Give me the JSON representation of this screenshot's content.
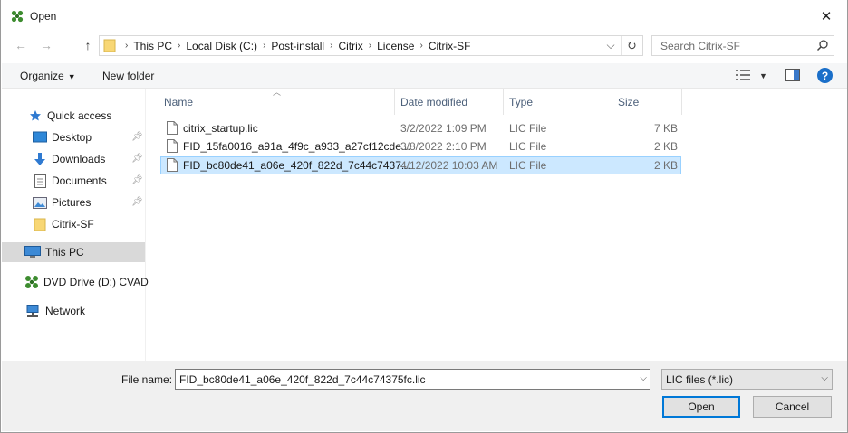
{
  "window": {
    "title": "Open",
    "close_glyph": "✕"
  },
  "nav_buttons": {
    "back": "←",
    "forward": "→",
    "up": "↑",
    "refresh": "↻",
    "address_dropdown": "⌵"
  },
  "address": {
    "crumbs": [
      "This PC",
      "Local Disk (C:)",
      "Post-install",
      "Citrix",
      "License",
      "Citrix-SF"
    ]
  },
  "search": {
    "placeholder": "Search Citrix-SF"
  },
  "toolbar": {
    "organize_label": "Organize",
    "new_folder_label": "New folder",
    "help_label": "?"
  },
  "sidebar": {
    "items": [
      {
        "label": "Quick access",
        "icon": "star-icon"
      },
      {
        "label": "Desktop",
        "icon": "desktop-icon",
        "pinned": true
      },
      {
        "label": "Downloads",
        "icon": "download-icon",
        "pinned": true
      },
      {
        "label": "Documents",
        "icon": "documents-icon",
        "pinned": true
      },
      {
        "label": "Pictures",
        "icon": "pictures-icon",
        "pinned": true
      },
      {
        "label": "Citrix-SF",
        "icon": "folder-icon"
      },
      {
        "label": "This PC",
        "icon": "computer-icon",
        "selected": true
      },
      {
        "label": "DVD Drive (D:) CVAD",
        "icon": "dvd-drive-icon"
      },
      {
        "label": "Network",
        "icon": "network-icon"
      }
    ]
  },
  "columns": {
    "name": "Name",
    "date": "Date modified",
    "type": "Type",
    "size": "Size"
  },
  "files": [
    {
      "name": "citrix_startup.lic",
      "date": "3/2/2022 1:09 PM",
      "type": "LIC File",
      "size": "7 KB"
    },
    {
      "name": "FID_15fa0016_a91a_4f9c_a933_a27cf12cde...",
      "date": "3/8/2022 2:10 PM",
      "type": "LIC File",
      "size": "2 KB"
    },
    {
      "name": "FID_bc80de41_a06e_420f_822d_7c44c7437...",
      "date": "4/12/2022 10:03 AM",
      "type": "LIC File",
      "size": "2 KB",
      "selected": true
    }
  ],
  "bottom": {
    "file_name_label": "File name:",
    "file_name_value": "FID_bc80de41_a06e_420f_822d_7c44c74375fc.lic",
    "filter_value": "LIC files (*.lic)",
    "open_label": "Open",
    "cancel_label": "Cancel"
  },
  "colors": {
    "accent": "#0078d7",
    "selection_bg": "#cce8ff",
    "selection_border": "#99d1ff",
    "citrix_green": "#3d8c2f",
    "folder_yellow": "#f8d775"
  }
}
